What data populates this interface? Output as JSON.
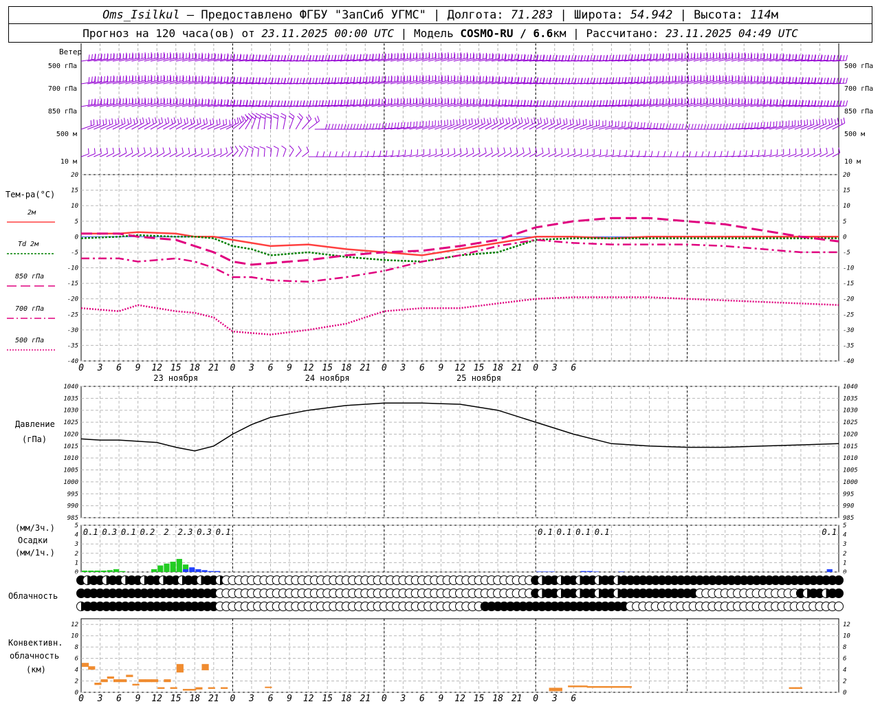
{
  "header": {
    "station": "Oms_Isilkul",
    "dash": "–",
    "provided": "Предоставлено ФГБУ \"ЗапСиб УГМС\"",
    "lon_label": "Долгота:",
    "lon_value": "71.283",
    "lat_label": "Широта:",
    "lat_value": "54.942",
    "alt_label": "Высота:",
    "alt_value": "114",
    "alt_unit": "м",
    "sep": "|",
    "forecast_label": "Прогноз на 120 часа(ов) от",
    "forecast_time": "23.11.2025 00:00 UTC",
    "model_label": "Модель",
    "model_name": "COSMO-RU / 6.6",
    "model_unit": "км",
    "calc_label": "Рассчитано:",
    "calc_time": "23.11.2025 04:49 UTC"
  },
  "labels": {
    "wind_title": "Ветер",
    "wind_levels": [
      "500 гПа",
      "700 гПа",
      "850 гПа",
      "500 м",
      "10  м"
    ],
    "temp_title": "Тем-ра(°C)",
    "temp_legend": [
      {
        "label": "2м",
        "color": "#ff4040",
        "dash": ""
      },
      {
        "label": "Td 2м",
        "color": "#008000",
        "dash": "3,2"
      },
      {
        "label": "850 гПа",
        "color": "#e0007f",
        "dash": "14,6"
      },
      {
        "label": "700 гПа",
        "color": "#e0007f",
        "dash": "10,4,2,4"
      },
      {
        "label": "500 гПа",
        "color": "#e0007f",
        "dash": "2,2"
      }
    ],
    "pressure_title": "Давление",
    "pressure_unit": "(гПа)",
    "precip_unit3": "(мм/3ч.)",
    "precip_title": "Осадки",
    "precip_unit1": "(мм/1ч.)",
    "cloud_title": "Облачность",
    "conv_title1": "Конвективн.",
    "conv_title2": "облачность",
    "conv_unit": "(км)"
  },
  "chart_data": [
    {
      "type": "barbs",
      "title": "Ветер",
      "hours": [
        0,
        120
      ],
      "levels": [
        "500 гПа",
        "700 гПа",
        "850 гПа",
        "500 м",
        "10  м"
      ],
      "colors": {
        "barb": "#9400d3"
      }
    },
    {
      "type": "line",
      "title": "Тем-ра(°C)",
      "ylim": [
        -40,
        20
      ],
      "yticks": [
        20,
        15,
        10,
        5,
        0,
        -5,
        -10,
        -15,
        -20,
        -25,
        -30,
        -35,
        -40
      ],
      "x": [
        0,
        6,
        9,
        15,
        18,
        21,
        24,
        27,
        30,
        36,
        42,
        48,
        54,
        60,
        66,
        72,
        78,
        84,
        90,
        96,
        102,
        108,
        114,
        120
      ],
      "series": [
        {
          "name": "2м",
          "color": "#ff4040",
          "values": [
            1,
            1,
            1.5,
            1,
            0,
            0,
            -1,
            -2,
            -3,
            -2.5,
            -4,
            -5,
            -6,
            -4,
            -2,
            0,
            0,
            -0.5,
            0,
            0,
            0,
            0,
            0,
            0
          ]
        },
        {
          "name": "Td 2м",
          "color": "#008000",
          "values": [
            -0.5,
            0,
            0.5,
            0,
            0,
            -0.5,
            -3,
            -4,
            -6,
            -5,
            -6.5,
            -7.5,
            -8,
            -6,
            -5,
            -1,
            -0.5,
            -0.5,
            -0.5,
            -0.5,
            -0.5,
            -0.5,
            -0.5,
            -0.5
          ]
        },
        {
          "name": "850 гПа",
          "color": "#e0007f",
          "values": [
            1,
            1,
            0,
            -1,
            -3,
            -5,
            -8,
            -9,
            -8.5,
            -7.5,
            -6,
            -5,
            -4.5,
            -3,
            -1,
            3,
            5,
            6,
            6,
            5,
            4,
            2,
            0,
            -1.5
          ]
        },
        {
          "name": "700 гПа",
          "color": "#e0007f",
          "values": [
            -7,
            -7,
            -8,
            -7,
            -8,
            -10,
            -13,
            -13,
            -14,
            -14.5,
            -13,
            -11,
            -8,
            -6,
            -3,
            -1,
            -2,
            -2.5,
            -2.5,
            -2.5,
            -3,
            -4,
            -5,
            -5
          ]
        },
        {
          "name": "500 гПа",
          "color": "#e0007f",
          "values": [
            -23,
            -24,
            -22,
            -24,
            -24.5,
            -26,
            -30.5,
            -31,
            -31.5,
            -30,
            -28,
            -24,
            -23,
            -23,
            -21.5,
            -20,
            -19.5,
            -19.5,
            -19.5,
            -20,
            -20.5,
            -21,
            -21.5,
            -22
          ]
        }
      ]
    },
    {
      "type": "line",
      "title": "Давление",
      "ylabel": "(гПа)",
      "ylim": [
        985,
        1040
      ],
      "yticks": [
        1040,
        1035,
        1030,
        1025,
        1020,
        1015,
        1010,
        1005,
        1000,
        995,
        990,
        985
      ],
      "x": [
        0,
        3,
        6,
        9,
        12,
        15,
        18,
        21,
        24,
        27,
        30,
        36,
        42,
        48,
        54,
        60,
        66,
        72,
        78,
        84,
        90,
        96,
        102,
        108,
        114,
        120
      ],
      "values": [
        1018,
        1017.5,
        1017.5,
        1017,
        1016.5,
        1014.5,
        1013,
        1015,
        1020,
        1024,
        1027,
        1030,
        1032,
        1033,
        1033,
        1032.5,
        1030,
        1025,
        1020,
        1016,
        1015,
        1014.5,
        1014.5,
        1015,
        1015.5,
        1016
      ]
    },
    {
      "type": "bar",
      "title": "Осадки",
      "ylabel": "(мм/1ч.)",
      "ylim": [
        0,
        5
      ],
      "yticks": [
        5,
        4,
        3,
        2,
        1,
        0
      ],
      "hourly_green": [
        {
          "h": 1,
          "v": 0.15
        },
        {
          "h": 2,
          "v": 0.15
        },
        {
          "h": 3,
          "v": 0.15
        },
        {
          "h": 4,
          "v": 0.15
        },
        {
          "h": 5,
          "v": 0.2
        },
        {
          "h": 6,
          "v": 0.3
        },
        {
          "h": 7,
          "v": 0.1
        },
        {
          "h": 12,
          "v": 0.3
        },
        {
          "h": 13,
          "v": 0.7
        },
        {
          "h": 14,
          "v": 0.9
        },
        {
          "h": 15,
          "v": 1.1
        },
        {
          "h": 16,
          "v": 1.4
        },
        {
          "h": 17,
          "v": 0.8
        }
      ],
      "hourly_blue": [
        {
          "h": 17,
          "v": 0.3
        },
        {
          "h": 18,
          "v": 0.5
        },
        {
          "h": 19,
          "v": 0.3
        },
        {
          "h": 20,
          "v": 0.2
        },
        {
          "h": 21,
          "v": 0.1
        },
        {
          "h": 22,
          "v": 0.1
        },
        {
          "h": 73,
          "v": 0.05
        },
        {
          "h": 74,
          "v": 0.05
        },
        {
          "h": 75,
          "v": 0.05
        },
        {
          "h": 80,
          "v": 0.1
        },
        {
          "h": 81,
          "v": 0.1
        },
        {
          "h": 82,
          "v": 0.05
        },
        {
          "h": 86,
          "v": 0.05
        },
        {
          "h": 119,
          "v": 0.3
        }
      ],
      "totals_3h": [
        {
          "h": 1.5,
          "label": "0.1"
        },
        {
          "h": 4.5,
          "label": "0.3"
        },
        {
          "h": 7.5,
          "label": "0.1"
        },
        {
          "h": 10.5,
          "label": "0.2"
        },
        {
          "h": 13.5,
          "label": "2"
        },
        {
          "h": 16.5,
          "label": "2.3"
        },
        {
          "h": 19.5,
          "label": "0.3"
        },
        {
          "h": 22.5,
          "label": "0.1"
        },
        {
          "h": 73.5,
          "label": "0.1"
        },
        {
          "h": 76.5,
          "label": "0.1"
        },
        {
          "h": 79.5,
          "label": "0.1"
        },
        {
          "h": 82.5,
          "label": "0.1"
        },
        {
          "h": 118.5,
          "label": "0.1"
        }
      ]
    },
    {
      "type": "symbols",
      "title": "Облачность",
      "rows": [
        {
          "segments": [
            [
              0,
              23,
              "mixed"
            ],
            [
              23,
              72,
              "clear"
            ],
            [
              72,
              88,
              "mixed"
            ],
            [
              88,
              120,
              "overcast"
            ]
          ]
        },
        {
          "segments": [
            [
              0,
              22,
              "overcast"
            ],
            [
              22,
              72,
              "clear"
            ],
            [
              72,
              86,
              "mixed"
            ],
            [
              86,
              98,
              "overcast"
            ],
            [
              98,
              114,
              "clear"
            ],
            [
              114,
              120,
              "mixed"
            ]
          ]
        },
        {
          "segments": [
            [
              0,
              1,
              "half"
            ],
            [
              1,
              22,
              "overcast"
            ],
            [
              22,
              46,
              "clear"
            ],
            [
              46,
              64,
              "clear"
            ],
            [
              64,
              87,
              "overcast"
            ],
            [
              87,
              120,
              "clear"
            ]
          ]
        }
      ]
    },
    {
      "type": "bar",
      "title": "Конвективн. облачность",
      "ylabel": "(км)",
      "ylim": [
        0,
        13
      ],
      "yticks": [
        12,
        10,
        8,
        6,
        4,
        2,
        0
      ],
      "color": "#f08c30",
      "cells": [
        {
          "h": 1,
          "lo": 4.5,
          "hi": 5.2
        },
        {
          "h": 2,
          "lo": 4,
          "hi": 4.6
        },
        {
          "h": 3,
          "lo": 1.3,
          "hi": 1.7
        },
        {
          "h": 4,
          "lo": 1.8,
          "hi": 2.3
        },
        {
          "h": 5,
          "lo": 2.4,
          "hi": 2.8
        },
        {
          "h": 6,
          "lo": 1.8,
          "hi": 2.3
        },
        {
          "h": 7,
          "lo": 1.8,
          "hi": 2.3
        },
        {
          "h": 8,
          "lo": 2.7,
          "hi": 3.1
        },
        {
          "h": 9,
          "lo": 1.2,
          "hi": 1.5
        },
        {
          "h": 10,
          "lo": 1.8,
          "hi": 2.3
        },
        {
          "h": 11,
          "lo": 1.8,
          "hi": 2.3
        },
        {
          "h": 12,
          "lo": 1.8,
          "hi": 2.3
        },
        {
          "h": 13,
          "lo": 0.6,
          "hi": 0.9
        },
        {
          "h": 14,
          "lo": 1.8,
          "hi": 2.3
        },
        {
          "h": 15,
          "lo": 0.6,
          "hi": 0.9
        },
        {
          "h": 16,
          "lo": 3.5,
          "hi": 5
        },
        {
          "h": 17,
          "lo": 0.3,
          "hi": 0.6
        },
        {
          "h": 18,
          "lo": 0.3,
          "hi": 0.6
        },
        {
          "h": 19,
          "lo": 0.5,
          "hi": 0.9
        },
        {
          "h": 20,
          "lo": 3.9,
          "hi": 5
        },
        {
          "h": 21,
          "lo": 0.6,
          "hi": 0.9
        },
        {
          "h": 23,
          "lo": 0.6,
          "hi": 0.9
        },
        {
          "h": 30,
          "lo": 0.8,
          "hi": 1
        },
        {
          "h": 75,
          "lo": 0.2,
          "hi": 0.8
        },
        {
          "h": 76,
          "lo": 0.2,
          "hi": 0.8
        },
        {
          "h": 78,
          "lo": 0.9,
          "hi": 1.2
        },
        {
          "h": 79,
          "lo": 0.9,
          "hi": 1.2
        },
        {
          "h": 80,
          "lo": 0.9,
          "hi": 1.2
        },
        {
          "h": 81,
          "lo": 0.8,
          "hi": 1.1
        },
        {
          "h": 82,
          "lo": 0.8,
          "hi": 1.1
        },
        {
          "h": 83,
          "lo": 0.8,
          "hi": 1.1
        },
        {
          "h": 84,
          "lo": 0.8,
          "hi": 1.1
        },
        {
          "h": 85,
          "lo": 0.8,
          "hi": 1.1
        },
        {
          "h": 86,
          "lo": 0.8,
          "hi": 1.1
        },
        {
          "h": 87,
          "lo": 0.8,
          "hi": 1.1
        },
        {
          "h": 113,
          "lo": 0.6,
          "hi": 0.9
        },
        {
          "h": 114,
          "lo": 0.6,
          "hi": 0.9
        }
      ]
    }
  ],
  "time_axis": {
    "hour_labels": [
      "0",
      "3",
      "6",
      "9",
      "12",
      "15",
      "18",
      "21",
      "0",
      "3",
      "6",
      "9",
      "12",
      "15",
      "18",
      "21",
      "0",
      "3",
      "6",
      "9",
      "12",
      "15",
      "18",
      "21",
      "0",
      "3",
      "6"
    ],
    "dates": [
      "23 ноября",
      "24 ноября",
      "25 ноября"
    ]
  }
}
